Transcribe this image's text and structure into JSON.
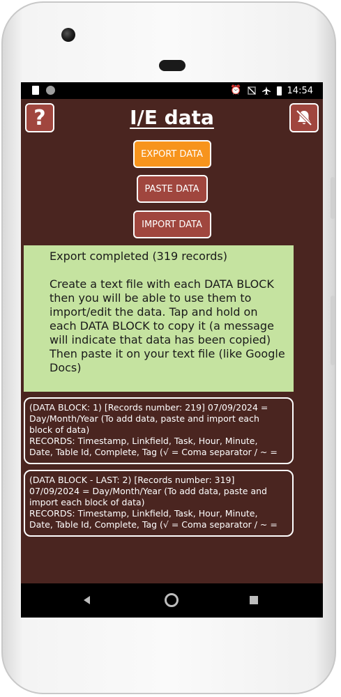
{
  "status_bar": {
    "time": "14:54",
    "icons": [
      "sd-card-icon",
      "circle-icon",
      "alarm-icon",
      "no-signal-icon",
      "airplane-icon",
      "battery-icon"
    ]
  },
  "header": {
    "title": "I/E data",
    "help_label": "?",
    "mute_icon": "bell-off-icon"
  },
  "actions": {
    "export_label": "EXPORT DATA",
    "paste_label": "PASTE DATA",
    "import_label": "IMPORT DATA"
  },
  "info": {
    "status": "Export completed (319 records)",
    "lines": [
      "Create a text file with each DATA BLOCK",
      "then you will be able to use them to",
      "import/edit the data. Tap and hold on",
      "each DATA BLOCK to copy it (a message",
      "will indicate that data has been copied)",
      "Then paste it on your text file (like Google",
      "Docs)"
    ]
  },
  "data_blocks": [
    {
      "lines": [
        "(DATA BLOCK: 1) [Records number: 219] 07/09/2024 =",
        "Day/Month/Year (To add data, paste and import each",
        "block of data)",
        "RECORDS: Timestamp, Linkfield, Task, Hour, Minute,",
        "Date, Table Id, Complete, Tag (√ = Coma separator / ~ ="
      ]
    },
    {
      "lines": [
        "(DATA BLOCK - LAST: 2) [Records number: 319]",
        "07/09/2024 = Day/Month/Year (To add data, paste and",
        "import each block of data)",
        "RECORDS: Timestamp, Linkfield, Task, Hour, Minute,",
        "Date, Table Id, Complete, Tag (√ = Coma separator / ~ ="
      ]
    }
  ],
  "colors": {
    "background": "#4a2520",
    "button": "#a0463e",
    "export_button": "#f7941d",
    "info_box": "#c5e3a0"
  }
}
